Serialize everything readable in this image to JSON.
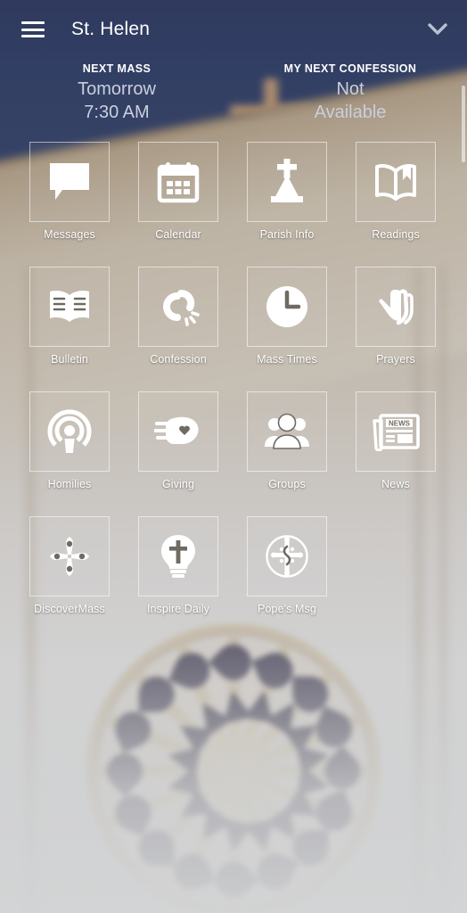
{
  "header": {
    "title": "St. Helen",
    "menu_icon": "hamburger-icon",
    "chevron_icon": "chevron-down-icon"
  },
  "status": {
    "next_mass": {
      "caption": "NEXT MASS",
      "value": "Tomorrow\n7:30 AM"
    },
    "next_confession": {
      "caption": "MY NEXT CONFESSION",
      "value": "Not\nAvailable"
    }
  },
  "colors": {
    "header_bg": "#313d62",
    "sky": "#354265",
    "stone": "#c7c0b5",
    "tile_border": "rgba(255,255,255,0.55)",
    "label": "#ffffff",
    "status_value": "#c9cfdc"
  },
  "grid": {
    "rows": [
      [
        {
          "label": "Messages",
          "icon": "message-bubble-icon"
        },
        {
          "label": "Calendar",
          "icon": "calendar-icon"
        },
        {
          "label": "Parish Info",
          "icon": "church-cross-icon"
        },
        {
          "label": "Readings",
          "icon": "open-book-bookmark-icon"
        }
      ],
      [
        {
          "label": "Bulletin",
          "icon": "open-book-lines-icon"
        },
        {
          "label": "Confession",
          "icon": "broken-chain-icon"
        },
        {
          "label": "Mass Times",
          "icon": "clock-icon"
        },
        {
          "label": "Prayers",
          "icon": "praying-hands-icon"
        }
      ],
      [
        {
          "label": "Homilies",
          "icon": "podcast-icon"
        },
        {
          "label": "Giving",
          "icon": "hand-heart-icon"
        },
        {
          "label": "Groups",
          "icon": "people-group-icon"
        },
        {
          "label": "News",
          "icon": "newspaper-icon"
        }
      ],
      [
        {
          "label": "DiscoverMass",
          "icon": "four-petal-pin-icon"
        },
        {
          "label": "Inspire Daily",
          "icon": "lightbulb-cross-icon"
        },
        {
          "label": "Pope's Msg",
          "icon": "papal-cross-circle-icon"
        }
      ]
    ]
  }
}
